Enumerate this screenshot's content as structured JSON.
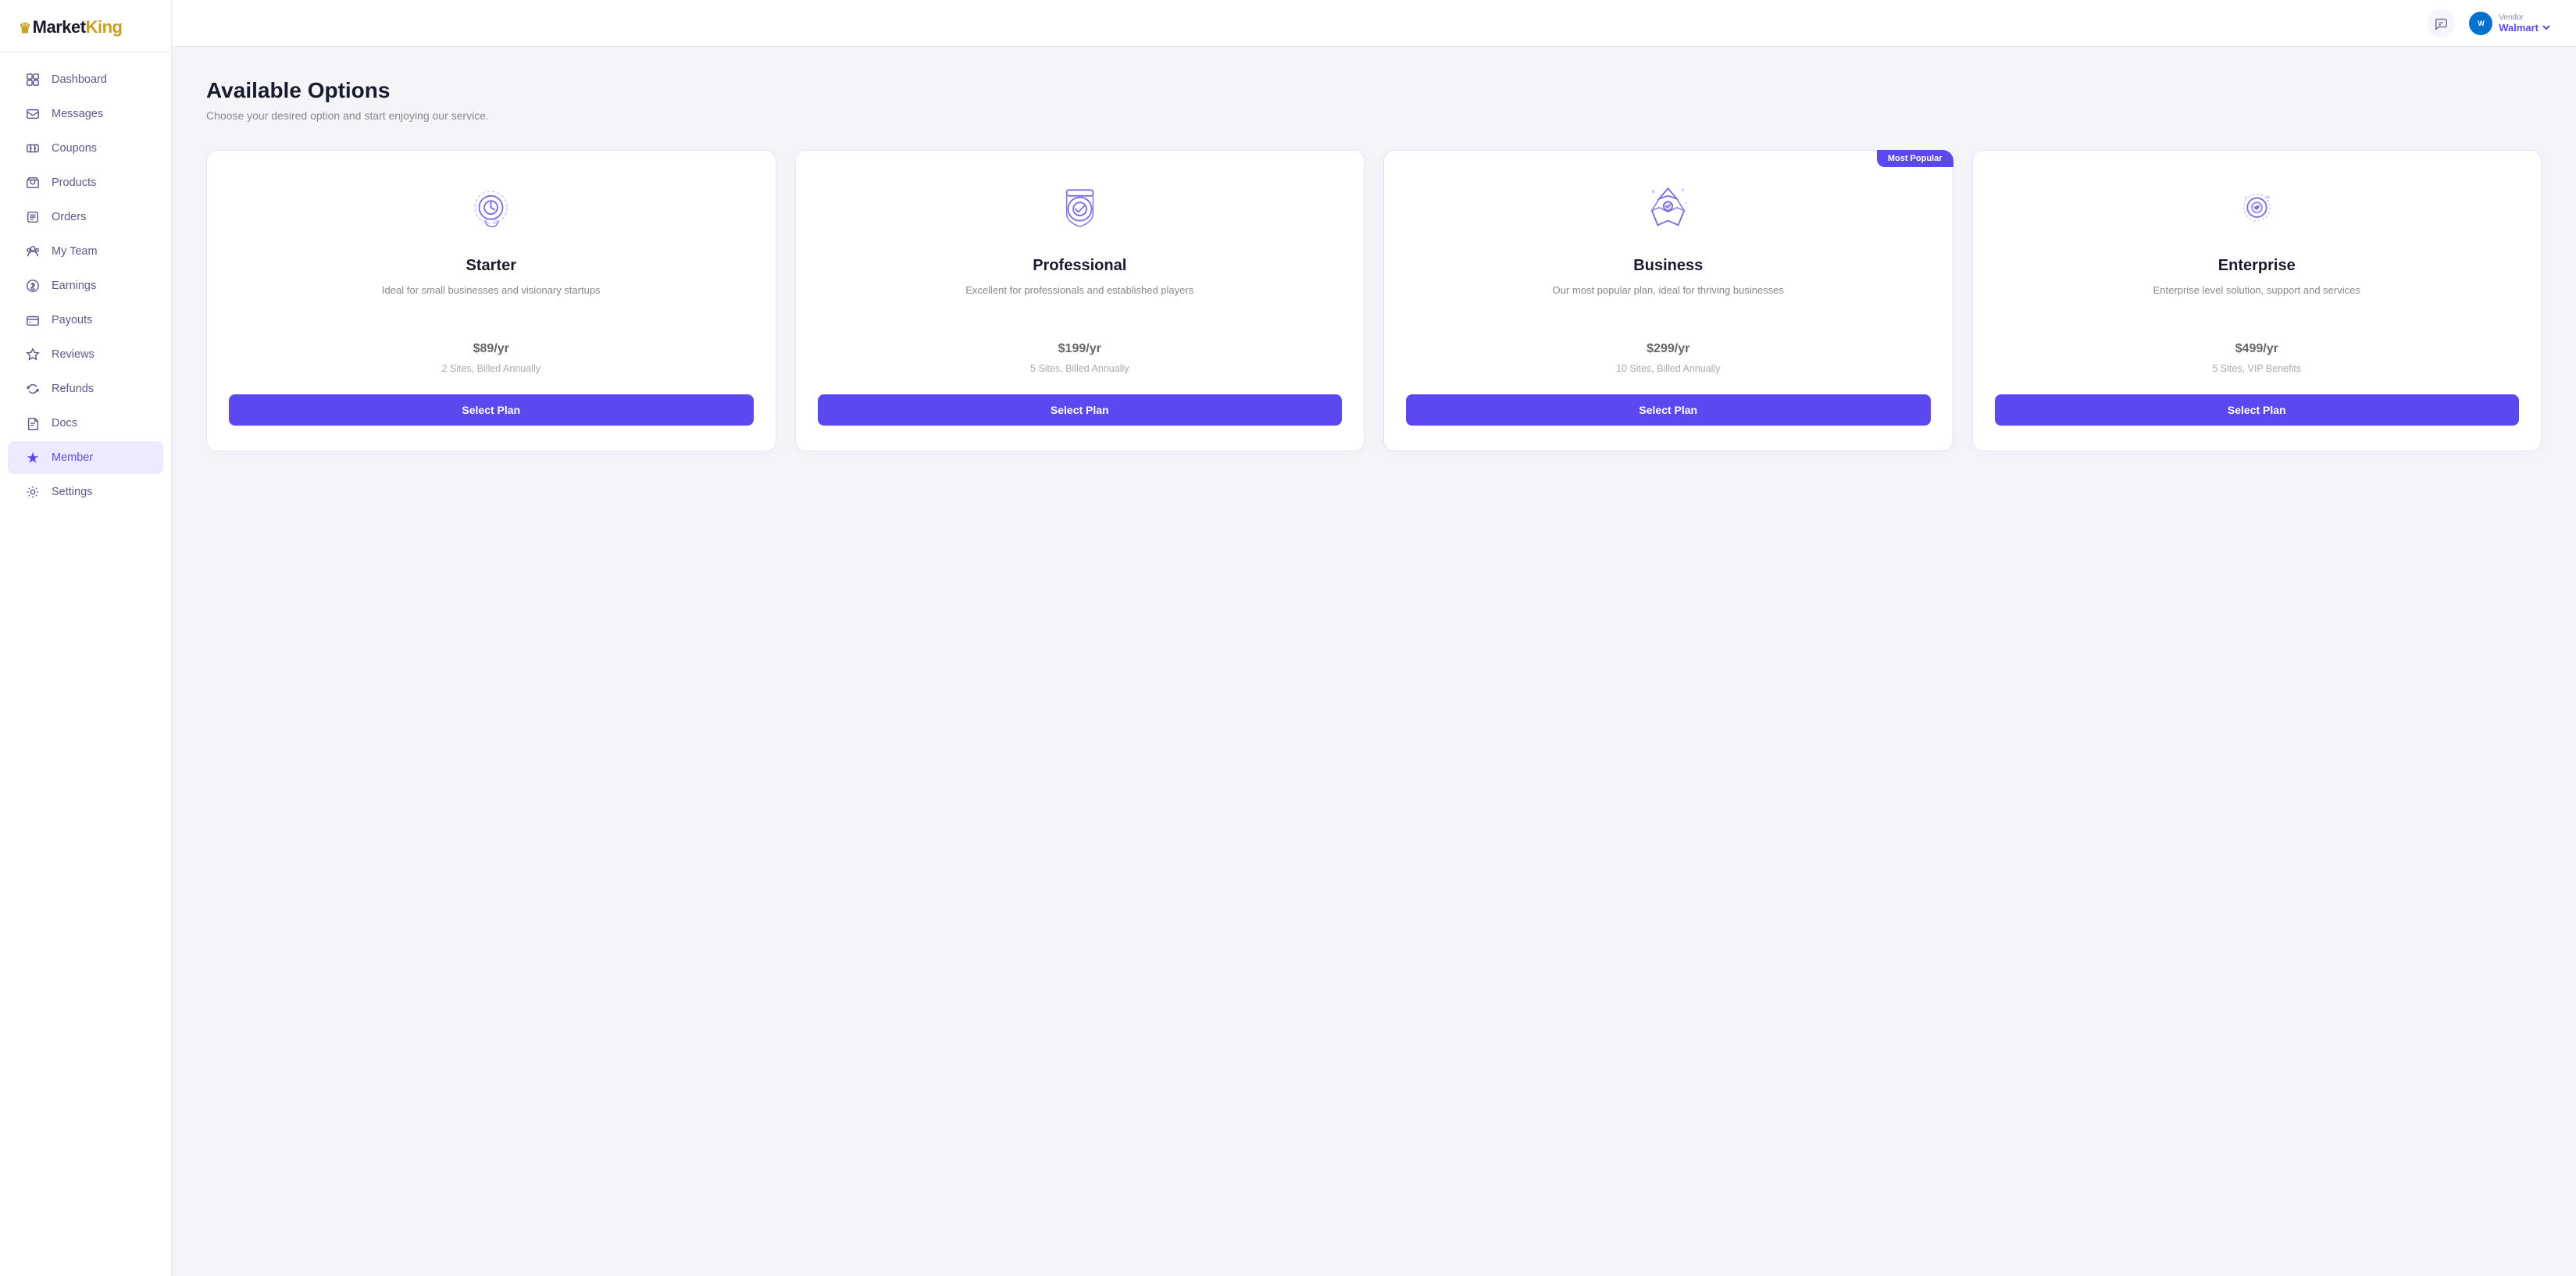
{
  "logo": {
    "prefix": "Market",
    "suffix": "King",
    "crown": "♛"
  },
  "sidebar": {
    "items": [
      {
        "id": "dashboard",
        "label": "Dashboard",
        "icon": "dashboard"
      },
      {
        "id": "messages",
        "label": "Messages",
        "icon": "messages"
      },
      {
        "id": "coupons",
        "label": "Coupons",
        "icon": "coupons"
      },
      {
        "id": "products",
        "label": "Products",
        "icon": "products"
      },
      {
        "id": "orders",
        "label": "Orders",
        "icon": "orders"
      },
      {
        "id": "my-team",
        "label": "My Team",
        "icon": "team"
      },
      {
        "id": "earnings",
        "label": "Earnings",
        "icon": "earnings"
      },
      {
        "id": "payouts",
        "label": "Payouts",
        "icon": "payouts"
      },
      {
        "id": "reviews",
        "label": "Reviews",
        "icon": "reviews"
      },
      {
        "id": "refunds",
        "label": "Refunds",
        "icon": "refunds"
      },
      {
        "id": "docs",
        "label": "Docs",
        "icon": "docs"
      },
      {
        "id": "member",
        "label": "Member",
        "icon": "member",
        "active": true
      }
    ],
    "bottom_items": [
      {
        "id": "settings",
        "label": "Settings",
        "icon": "settings"
      }
    ]
  },
  "topbar": {
    "vendor_label": "Vendor",
    "vendor_name": "Walmart",
    "vendor_logo_text": "W"
  },
  "page": {
    "title": "Available Options",
    "subtitle": "Choose your desired option and start enjoying our service."
  },
  "plans": [
    {
      "id": "starter",
      "name": "Starter",
      "description": "Ideal for small businesses and visionary startups",
      "price": "$89",
      "period": "/yr",
      "billing": "2 Sites, Billed Annually",
      "button_label": "Select Plan",
      "most_popular": false,
      "most_popular_label": ""
    },
    {
      "id": "professional",
      "name": "Professional",
      "description": "Excellent for professionals and established players",
      "price": "$199",
      "period": "/yr",
      "billing": "5 Sites, Billed Annually",
      "button_label": "Select Plan",
      "most_popular": false,
      "most_popular_label": ""
    },
    {
      "id": "business",
      "name": "Business",
      "description": "Our most popular plan, ideal for thriving businesses",
      "price": "$299",
      "period": "/yr",
      "billing": "10 Sites, Billed Annually",
      "button_label": "Select Plan",
      "most_popular": true,
      "most_popular_label": "Most Popular"
    },
    {
      "id": "enterprise",
      "name": "Enterprise",
      "description": "Enterprise level solution, support and services",
      "price": "$499",
      "period": "/yr",
      "billing": "5 Sites, VIP Benefits",
      "button_label": "Select Plan",
      "most_popular": false,
      "most_popular_label": ""
    }
  ],
  "colors": {
    "accent": "#5b48ee",
    "accent_dark": "#4835d4",
    "gold": "#c8a020",
    "text_dark": "#1a1a2e",
    "text_muted": "#888888",
    "badge_bg": "#5b48ee"
  }
}
